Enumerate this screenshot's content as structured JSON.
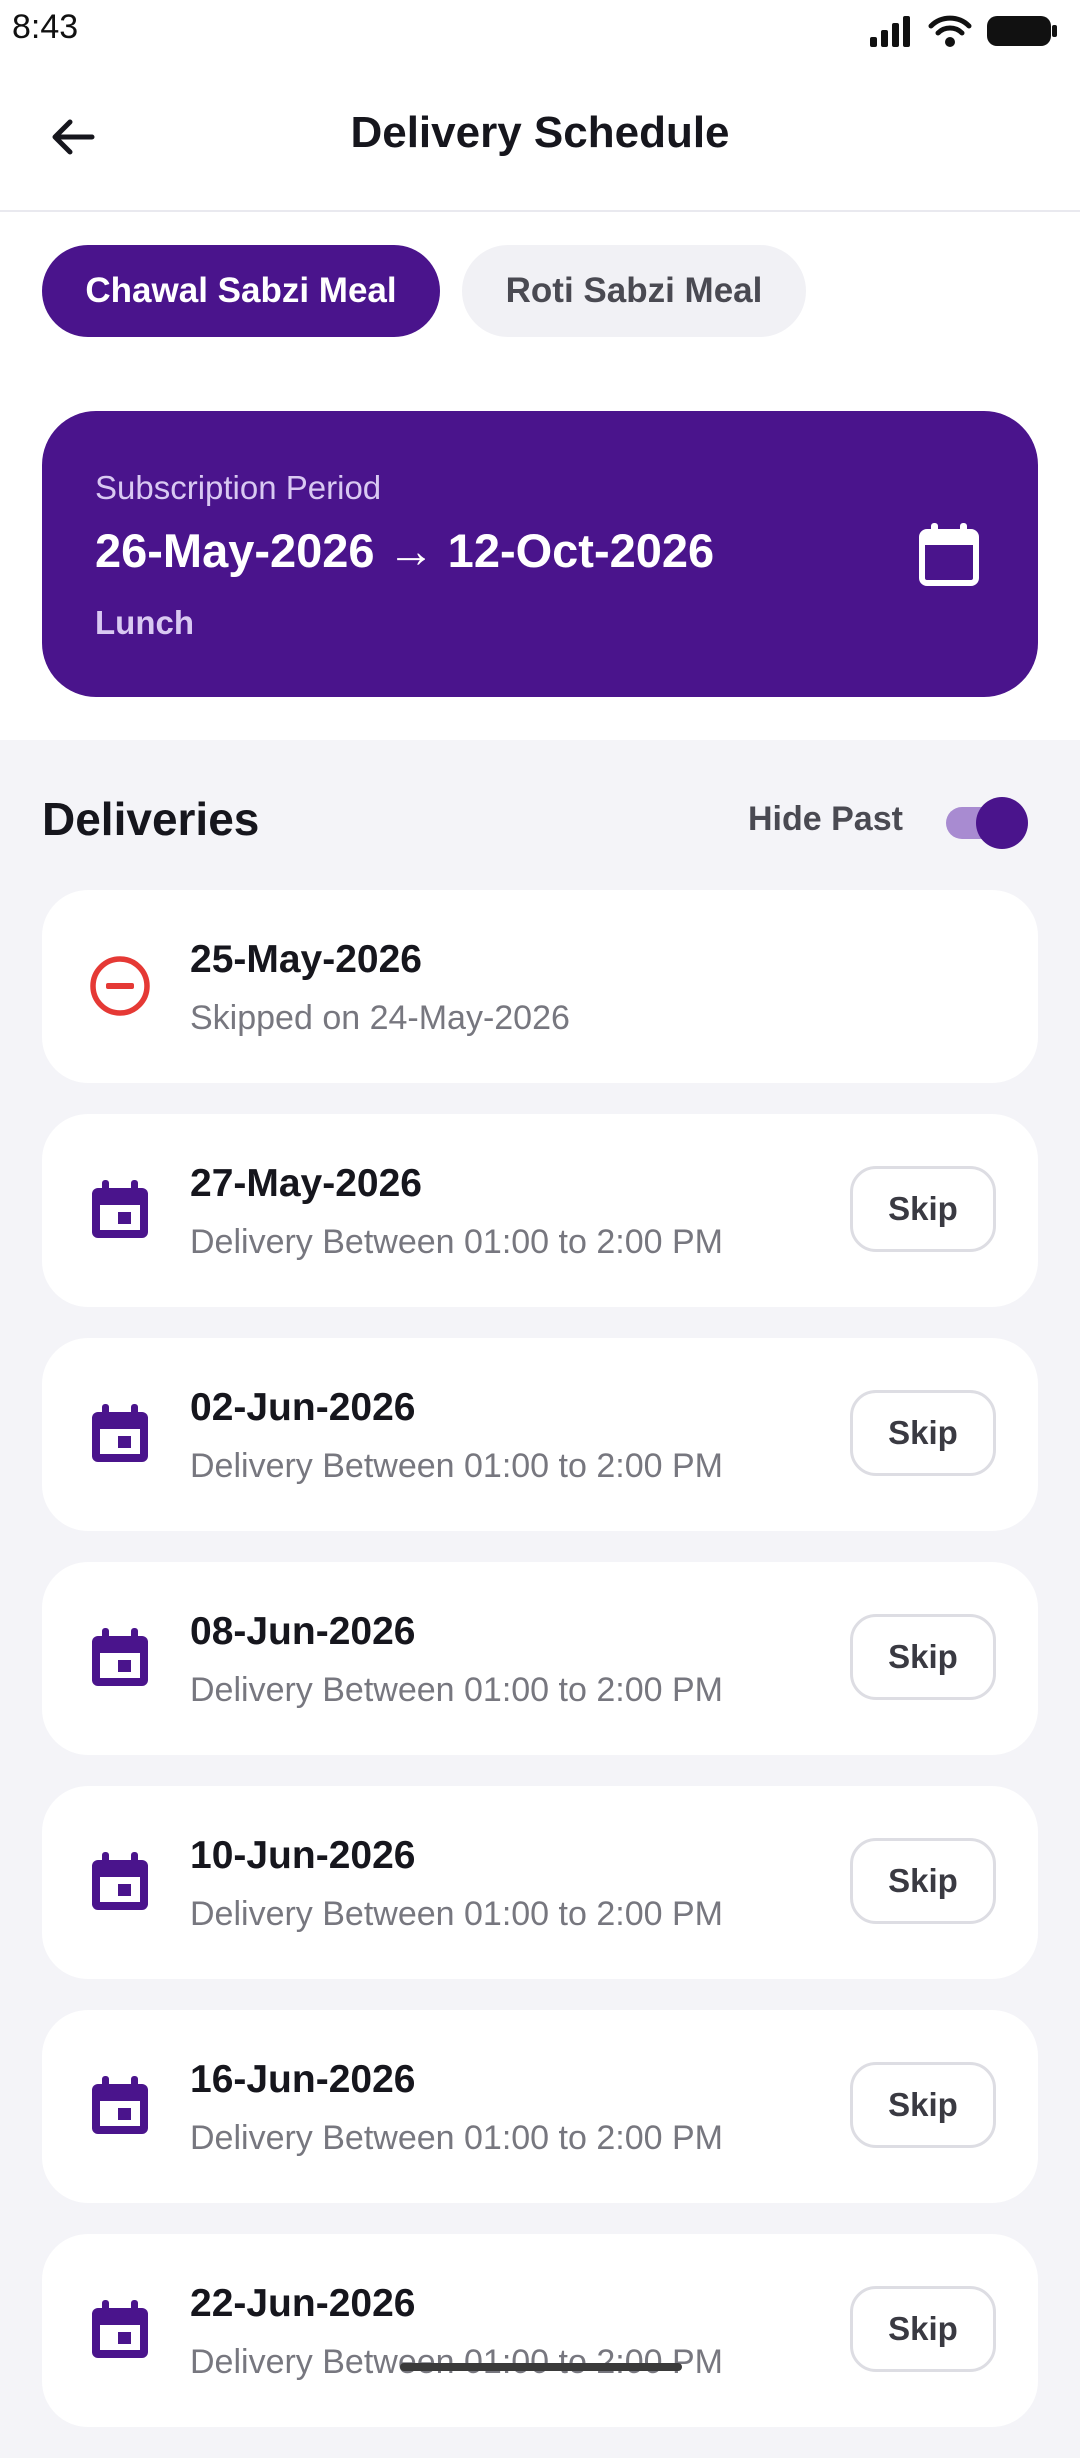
{
  "status_bar": {
    "time": "8:43"
  },
  "app_bar": {
    "title": "Delivery Schedule"
  },
  "meal_tabs": [
    {
      "label": "Chawal Sabzi Meal",
      "selected": true
    },
    {
      "label": "Roti Sabzi Meal",
      "selected": false
    }
  ],
  "subscription": {
    "label": "Subscription Period",
    "range": "26-May-2026 → 12-Oct-2026",
    "meal_time": "Lunch"
  },
  "deliveries": {
    "title": "Deliveries",
    "hide_past_label": "Hide Past",
    "hide_past_on": true,
    "items": [
      {
        "date": "25-May-2026",
        "subtitle": "Skipped on 24-May-2026",
        "status": "skipped"
      },
      {
        "date": "27-May-2026",
        "subtitle": "Delivery Between 01:00 to 2:00 PM",
        "status": "scheduled",
        "action": "Skip"
      },
      {
        "date": "02-Jun-2026",
        "subtitle": "Delivery Between 01:00 to 2:00 PM",
        "status": "scheduled",
        "action": "Skip"
      },
      {
        "date": "08-Jun-2026",
        "subtitle": "Delivery Between 01:00 to 2:00 PM",
        "status": "scheduled",
        "action": "Skip"
      },
      {
        "date": "10-Jun-2026",
        "subtitle": "Delivery Between 01:00 to 2:00 PM",
        "status": "scheduled",
        "action": "Skip"
      },
      {
        "date": "16-Jun-2026",
        "subtitle": "Delivery Between 01:00 to 2:00 PM",
        "status": "scheduled",
        "action": "Skip"
      },
      {
        "date": "22-Jun-2026",
        "subtitle": "Delivery Between 01:00 to 2:00 PM",
        "status": "scheduled",
        "action": "Skip"
      }
    ]
  },
  "icons": {
    "back": "arrow-left-icon",
    "period": "calendar-outline-icon",
    "scheduled": "calendar-event-icon",
    "skipped": "minus-circle-icon"
  },
  "colors": {
    "primary": "#4a148c",
    "primary_light": "#a88bd1",
    "skipped_red": "#e53935",
    "background": "#f4f4f8"
  }
}
